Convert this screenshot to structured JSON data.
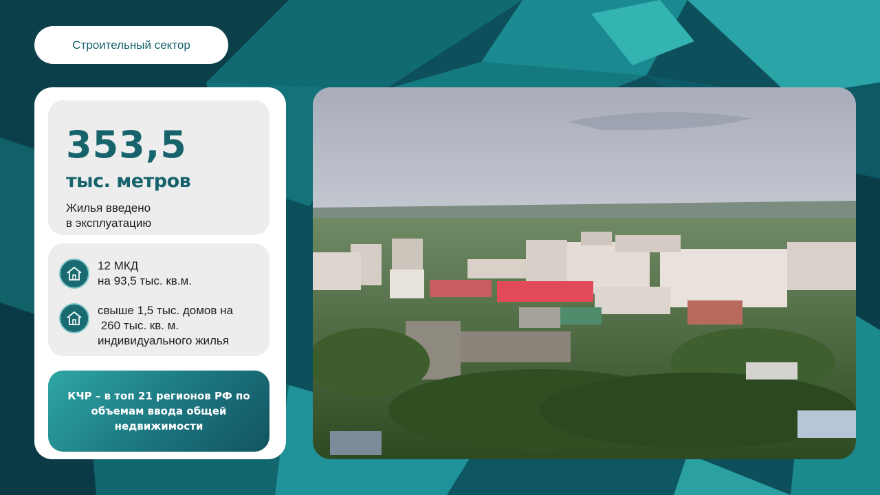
{
  "section_pill": {
    "label": "Строительный сектор"
  },
  "stat": {
    "value": "353,5",
    "unit": "тыс. метров",
    "description_line1": "Жилья введено",
    "description_line2": "в эксплуатацию"
  },
  "facts": [
    {
      "icon": "house-icon",
      "line1": "12 МКД",
      "line2": "на 93,5 тыс. кв.м."
    },
    {
      "icon": "house-icon",
      "line1": "свыше 1,5 тыс. домов на",
      "line2": " 260 тыс. кв. м.",
      "line3": "индивидуального жилья"
    }
  ],
  "banner": {
    "text": "КЧР – в топ 21 регионов РФ по объемам ввода общей недвижимости"
  },
  "colors": {
    "accent": "#17636c",
    "panel": "#ededed",
    "banner_start": "#2fa6a4",
    "banner_end": "#12545f"
  }
}
